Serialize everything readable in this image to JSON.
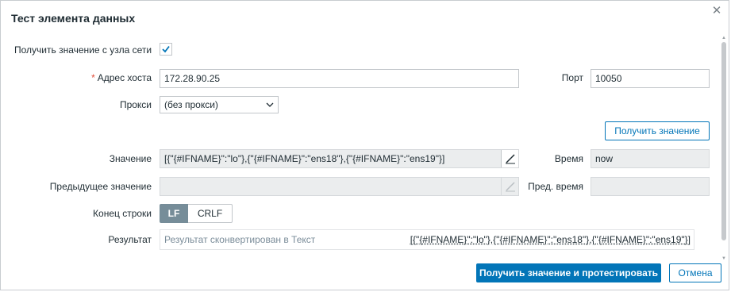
{
  "dialog": {
    "title": "Тест элемента данных",
    "close_icon": "close-icon"
  },
  "form": {
    "get_from_host_label": "Получить значение с узла сети",
    "get_from_host_checked": true,
    "host_address_label": "Адрес хоста",
    "host_address_value": "172.28.90.25",
    "port_label": "Порт",
    "port_value": "10050",
    "proxy_label": "Прокси",
    "proxy_selected": "(без прокси)",
    "get_value_button": "Получить значение",
    "value_label": "Значение",
    "value_value": "[{\"{#IFNAME}\":\"lo\"},{\"{#IFNAME}\":\"ens18\"},{\"{#IFNAME}\":\"ens19\"}]",
    "time_label": "Время",
    "time_value": "now",
    "prev_value_label": "Предыдущее значение",
    "prev_value_value": "",
    "prev_time_label": "Пред. время",
    "prev_time_value": "",
    "eol_label": "Конец строки",
    "eol_options": [
      "LF",
      "CRLF"
    ],
    "eol_selected": "LF",
    "result_label": "Результат",
    "result_hint": "Результат сконвертирован в Текст",
    "result_value": "[{\"{#IFNAME}\":\"lo\"},{\"{#IFNAME}\":\"ens18\"},{\"{#IFNAME}\":\"ens19\"}]"
  },
  "footer": {
    "test_button": "Получить значение и протестировать",
    "cancel_button": "Отмена"
  },
  "colors": {
    "accent": "#0275b8",
    "required": "#e04b38",
    "toggle_on": "#768d99"
  }
}
